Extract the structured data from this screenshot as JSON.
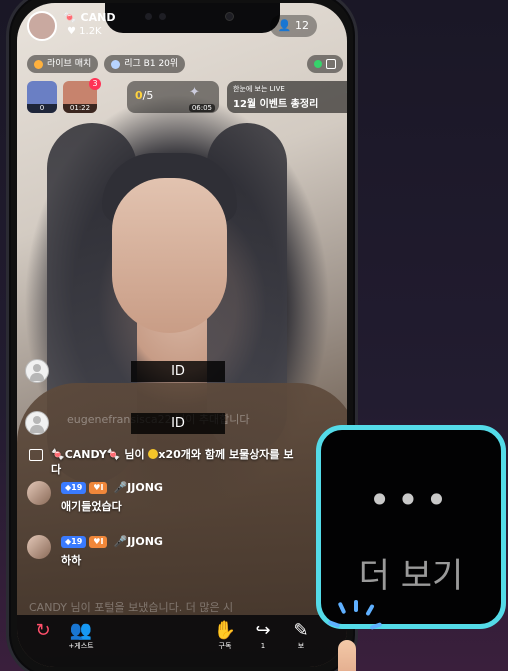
{
  "stream": {
    "streamer_name": "CAND",
    "likes": "1.2K",
    "viewers": "12"
  },
  "tags": [
    {
      "label": "라이브 매치",
      "color": "#ffb13d"
    },
    {
      "label": "리그 B1 20위",
      "color": "#b7d4ff"
    }
  ],
  "widgets": {
    "w1_label": "0",
    "w2_label": "01:22",
    "w2_badge": "3",
    "mission_count": "0",
    "mission_total": "/5",
    "mission_time": "06:05",
    "event_sub": "한눈에 보는 LIVE",
    "event_title": "12월 이벤트 총정리"
  },
  "id_label": "ID",
  "ghost_text": "eugenefransisca22 님이 추대합니다",
  "system_message": {
    "name": "CANDY",
    "text_pre": " 님이 ",
    "text_post": "x20개와 함께 보물상자를 보",
    "text_wrap": "다"
  },
  "messages": [
    {
      "badge_blue": "19",
      "badge_orange": "I",
      "nick": "JJONG",
      "text": "애기들었습다"
    },
    {
      "badge_blue": "19",
      "badge_orange": "I",
      "nick": "JJONG",
      "text": "하하"
    }
  ],
  "faded_line": "CANDY 님이 포털을 보냈습니다. 더 많은 시",
  "bottom_nav": {
    "guest_label": "+게스트",
    "subscribe_label": "구독",
    "share_label": "1",
    "edit_label": "보"
  },
  "more_button": {
    "dots": "•••",
    "label": "더 보기"
  },
  "colors": {
    "callout_border": "#54dbe8",
    "tap_indicator": "#5fb0ff",
    "guest_accent": "#d27bff"
  }
}
